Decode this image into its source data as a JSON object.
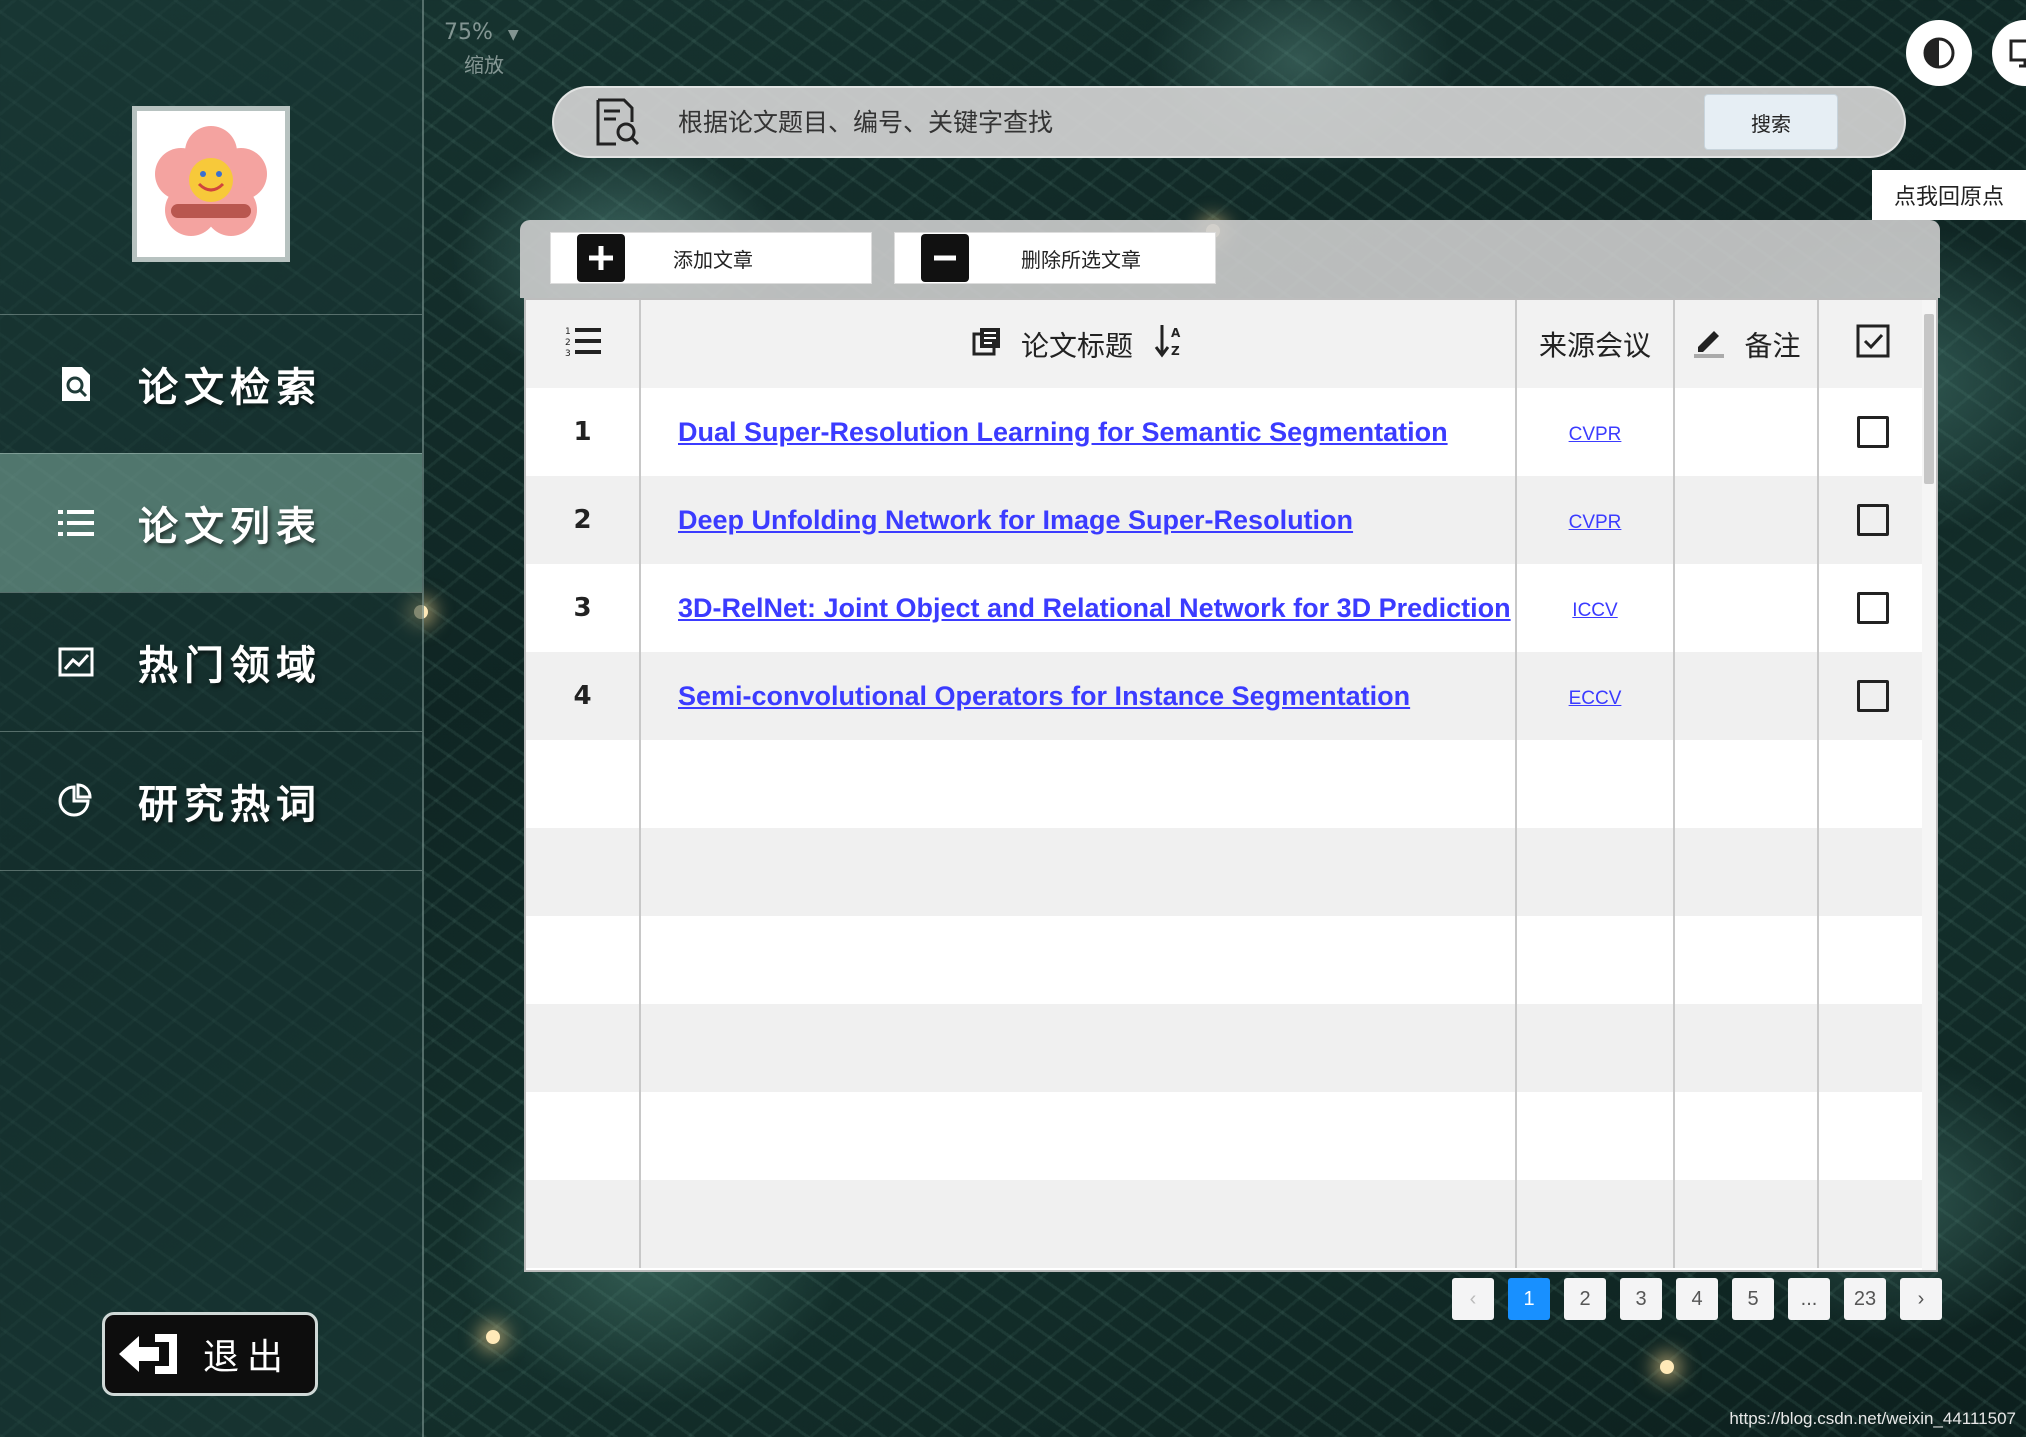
{
  "zoom": {
    "value": "75%",
    "caption": "缩放"
  },
  "sidebar": {
    "items": [
      {
        "label": "论文检索",
        "icon": "document-search-icon"
      },
      {
        "label": "论文列表",
        "icon": "list-icon",
        "active": true
      },
      {
        "label": "热门领域",
        "icon": "line-chart-icon"
      },
      {
        "label": "研究热词",
        "icon": "pie-chart-icon"
      }
    ],
    "logout_label": "退出"
  },
  "search": {
    "placeholder": "根据论文题目、编号、关键字查找",
    "button_label": "搜索"
  },
  "top_right": {
    "home_label": "点我回原点"
  },
  "toolbar": {
    "add_label": "添加文章",
    "delete_label": "删除所选文章"
  },
  "table": {
    "headers": {
      "title": "论文标题",
      "source": "来源会议",
      "note": "备注"
    },
    "rows": [
      {
        "index": "1",
        "title": "Dual Super-Resolution Learning for Semantic Segmentation",
        "source": "CVPR",
        "note": ""
      },
      {
        "index": "2",
        "title": "Deep Unfolding Network for Image Super-Resolution",
        "source": "CVPR",
        "note": ""
      },
      {
        "index": "3",
        "title": "3D-RelNet: Joint Object and Relational Network for 3D Prediction",
        "source": "ICCV",
        "note": ""
      },
      {
        "index": "4",
        "title": "Semi-convolutional Operators for Instance Segmentation",
        "source": "ECCV",
        "note": ""
      }
    ]
  },
  "pagination": {
    "pages": [
      "1",
      "2",
      "3",
      "4",
      "5",
      "...",
      "23"
    ],
    "current": "1"
  },
  "colors": {
    "accent": "#1890ff",
    "link": "#3b3bff",
    "active_nav": "#82afa0"
  },
  "watermark": "https://blog.csdn.net/weixin_44111507"
}
